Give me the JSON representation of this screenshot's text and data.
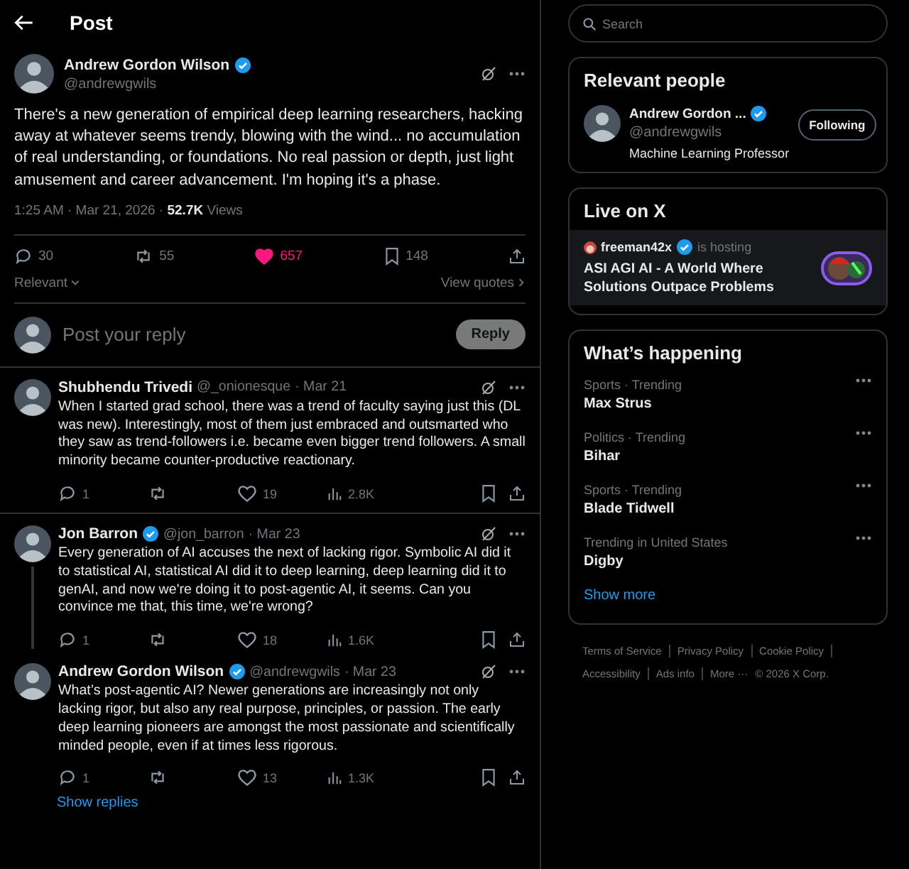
{
  "header": {
    "title": "Post"
  },
  "post": {
    "name": "Andrew Gordon Wilson",
    "verified": true,
    "handle": "@andrewgwils",
    "text": "There's a new generation of empirical deep learning researchers, hacking away at whatever seems trendy, blowing with the wind... no accumulation of real understanding, or foundations. No real passion or depth, just light amusement and career advancement. I'm hoping it's a phase.",
    "time": "1:25 AM · Mar 21, 2026 · ",
    "views_count": "52.7K",
    "views_label": "Views",
    "replies": "30",
    "reposts": "55",
    "likes": "657",
    "liked": true,
    "bookmarks": "148",
    "sort": "Relevant",
    "view_quotes": "View quotes"
  },
  "composer": {
    "placeholder": "Post your reply",
    "button": "Reply"
  },
  "replies": [
    {
      "name": "Shubhendu Trivedi",
      "verified": false,
      "handle": "@_onionesque",
      "date": "· Mar 21",
      "text": "When I started grad school, there was a trend of faculty saying just this (DL was new). Interestingly, most of them just embraced and outsmarted who they saw as trend-followers i.e. became even bigger trend followers. A small minority became counter-productive reactionary.",
      "replies": "1",
      "likes": "19",
      "liked": false,
      "views": "2.8K",
      "thread_line": false,
      "divider": true
    },
    {
      "name": "Jon Barron",
      "verified": true,
      "handle": "@jon_barron",
      "date": "· Mar 23",
      "text": "Every generation of AI accuses the next of lacking rigor. Symbolic AI did it to statistical AI, statistical AI did it to deep learning, deep learning did it to genAI, and now we're doing it to post-agentic AI, it seems. Can you convince me that, this time, we're wrong?",
      "replies": "1",
      "likes": "18",
      "liked": false,
      "views": "1.6K",
      "thread_line": true,
      "divider": false
    },
    {
      "name": "Andrew Gordon Wilson",
      "verified": true,
      "handle": "@andrewgwils",
      "date": "· Mar 23",
      "text": "What’s post-agentic AI? Newer generations are increasingly not only lacking rigor, but also any real purpose, principles, or passion. The early deep learning pioneers are amongst the most passionate and scientifically minded people, even if at times less rigorous.",
      "replies": "1",
      "likes": "13",
      "liked": false,
      "views": "1.3K",
      "thread_line": false,
      "divider": false
    }
  ],
  "show_replies": "Show replies",
  "search": {
    "placeholder": "Search"
  },
  "relevant_people": {
    "title": "Relevant people",
    "name": "Andrew Gordon ...",
    "verified": true,
    "handle": "@andrewgwils",
    "bio": "Machine Learning Professor",
    "button": "Following"
  },
  "live": {
    "title": "Live on X",
    "host": "freeman42x",
    "verified": true,
    "status": "is hosting",
    "text": "ASI AGI AI - A World Where Solutions Outpace Problems"
  },
  "trends": {
    "title": "What’s happening",
    "items": [
      {
        "context": "Sports · Trending",
        "name": "Max Strus"
      },
      {
        "context": "Politics · Trending",
        "name": "Bihar"
      },
      {
        "context": "Sports · Trending",
        "name": "Blade Tidwell"
      },
      {
        "context": "Trending in United States",
        "name": "Digby"
      }
    ],
    "show_more": "Show more"
  },
  "footer": {
    "links": [
      "Terms of Service",
      "Privacy Policy",
      "Cookie Policy",
      "Accessibility",
      "Ads info",
      "More ···"
    ],
    "copyright": "© 2026 X Corp."
  }
}
